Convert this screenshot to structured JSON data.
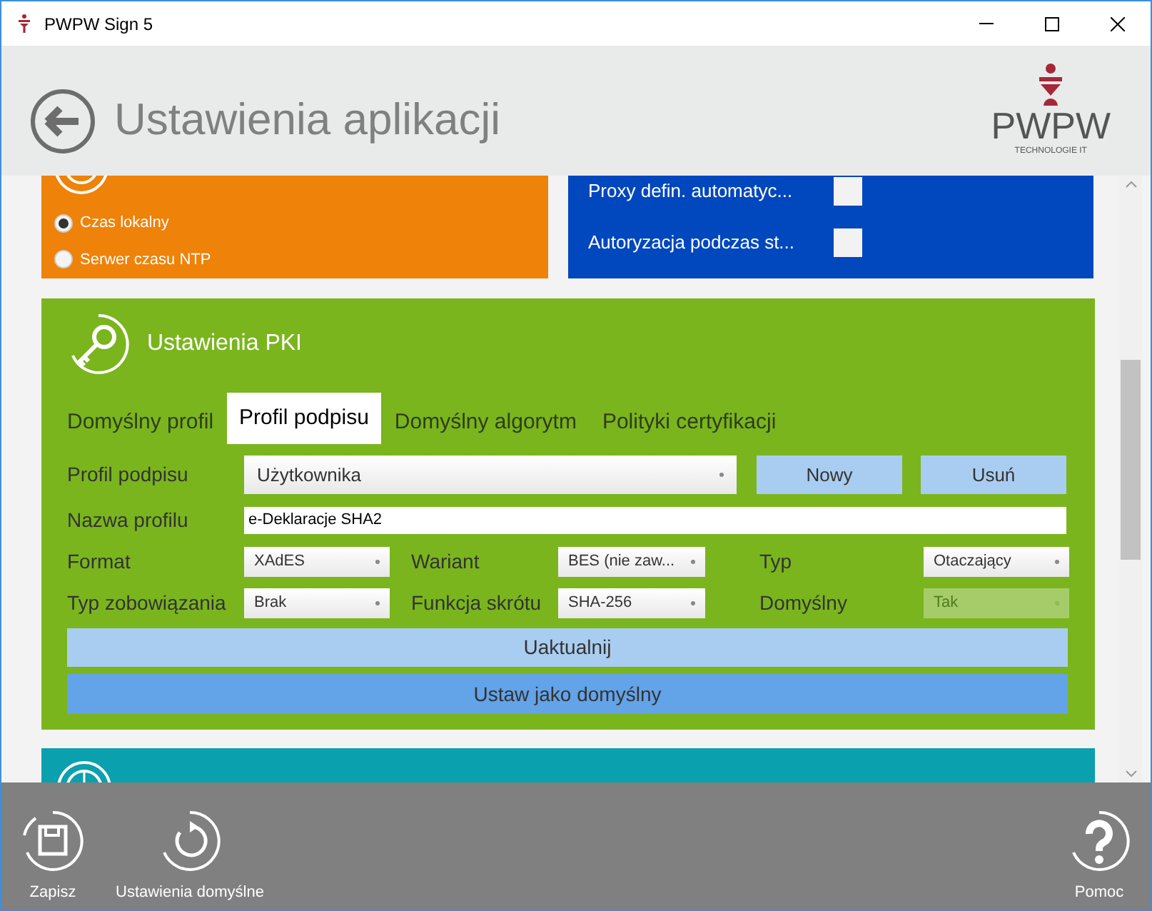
{
  "window": {
    "title": "PWPW Sign 5"
  },
  "header": {
    "title": "Ustawienia aplikacji",
    "logo_text": "PWPW",
    "logo_subtitle": "TECHNOLOGIE IT"
  },
  "time_source": {
    "options": [
      {
        "label": "Czas lokalny",
        "selected": true
      },
      {
        "label": "Serwer czasu NTP",
        "selected": false
      }
    ]
  },
  "proxy": {
    "options": [
      {
        "label": "Proxy defin. automatyc...",
        "checked": false
      },
      {
        "label": "Autoryzacja podczas st...",
        "checked": false
      }
    ]
  },
  "pki": {
    "title": "Ustawienia PKI",
    "tabs": [
      {
        "label": "Domyślny profil",
        "selected": false
      },
      {
        "label": "Profil podpisu",
        "selected": true
      },
      {
        "label": "Domyślny algorytm",
        "selected": false
      },
      {
        "label": "Polityki certyfikacji",
        "selected": false
      }
    ],
    "profile_label": "Profil podpisu",
    "profile_value": "Użytkownika",
    "buttons": [
      "Nowy",
      "Usuń"
    ],
    "name_label": "Nazwa profilu",
    "name_value": "e-Deklaracje SHA2",
    "fields": [
      {
        "label": "Format",
        "value": "XAdES",
        "disabled": false
      },
      {
        "label": "Wariant",
        "value": "BES (nie zaw...",
        "disabled": false
      },
      {
        "label": "Typ",
        "value": "Otaczający",
        "disabled": false
      },
      {
        "label": "Typ zobowiązania",
        "value": "Brak",
        "disabled": false
      },
      {
        "label": "Funkcja skrótu",
        "value": "SHA-256",
        "disabled": false
      },
      {
        "label": "Domyślny",
        "value": "Tak",
        "disabled": true
      }
    ],
    "update_button": "Uaktualnij",
    "default_button": "Ustaw jako domyślny"
  },
  "footer": [
    {
      "kind": "save",
      "label": "Zapisz"
    },
    {
      "kind": "reset",
      "label": "Ustawienia domyślne"
    },
    {
      "kind": "help",
      "label": "Pomoc"
    }
  ]
}
